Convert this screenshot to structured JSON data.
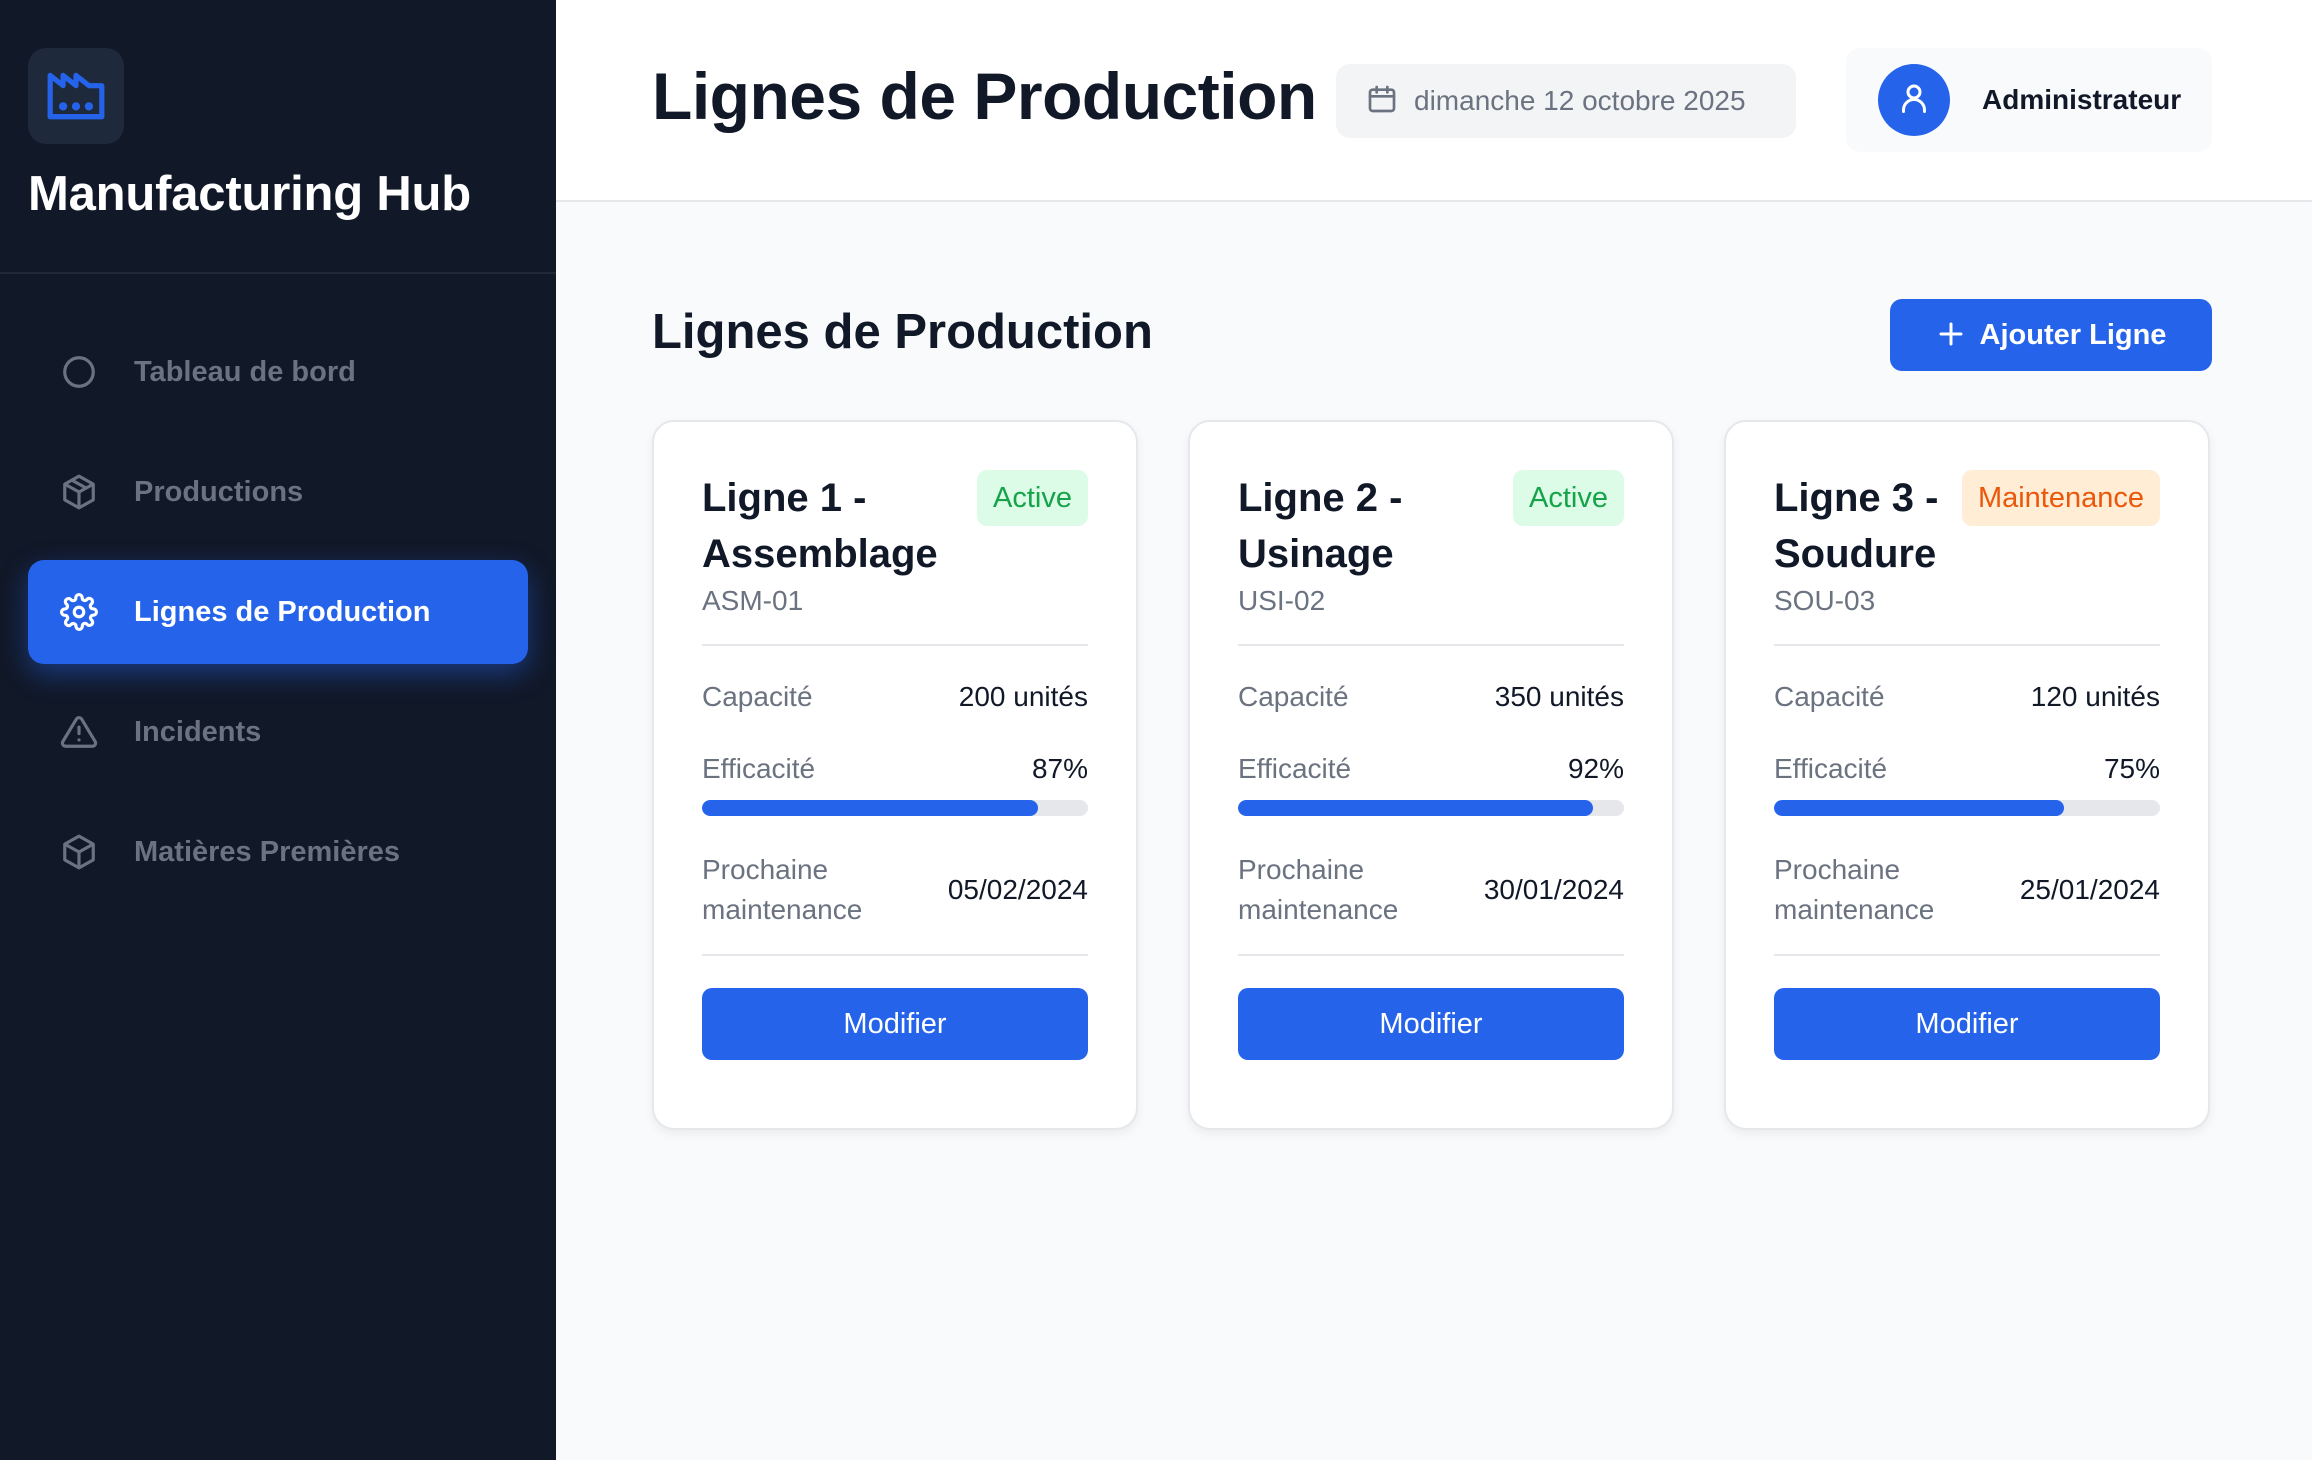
{
  "app": {
    "name": "Manufacturing Hub",
    "logo_icon": "factory-icon"
  },
  "sidebar": {
    "items": [
      {
        "label": "Tableau de bord",
        "icon": "circle-icon",
        "active": false
      },
      {
        "label": "Productions",
        "icon": "box-icon",
        "active": false
      },
      {
        "label": "Lignes de Production",
        "icon": "gear-icon",
        "active": true
      },
      {
        "label": "Incidents",
        "icon": "warning-triangle-icon",
        "active": false
      },
      {
        "label": "Matières Premières",
        "icon": "box-icon",
        "active": false
      }
    ]
  },
  "header": {
    "title": "Lignes de Production",
    "date": "dimanche 12 octobre 2025",
    "user": "Administrateur"
  },
  "main": {
    "section_title": "Lignes de Production",
    "add_button": "Ajouter Ligne",
    "labels": {
      "capacity": "Capacité",
      "efficiency": "Efficacité",
      "next_maintenance": "Prochaine maintenance",
      "edit": "Modifier"
    },
    "lines": [
      {
        "title": "Ligne 1 - Assemblage",
        "code": "ASM-01",
        "status": "Active",
        "status_type": "active",
        "capacity": "200 unités",
        "efficiency": "87%",
        "efficiency_value": 87,
        "next_maintenance": "05/02/2024"
      },
      {
        "title": "Ligne 2 - Usinage",
        "code": "USI-02",
        "status": "Active",
        "status_type": "active",
        "capacity": "350 unités",
        "efficiency": "92%",
        "efficiency_value": 92,
        "next_maintenance": "30/01/2024"
      },
      {
        "title": "Ligne 3 - Soudure",
        "code": "SOU-03",
        "status": "Maintenance",
        "status_type": "maintenance",
        "capacity": "120 unités",
        "efficiency": "75%",
        "efficiency_value": 75,
        "next_maintenance": "25/01/2024"
      }
    ]
  },
  "colors": {
    "sidebar_bg": "#111827",
    "accent": "#2563eb",
    "active_badge": "#16a34a",
    "maintenance_badge": "#ea580c"
  }
}
